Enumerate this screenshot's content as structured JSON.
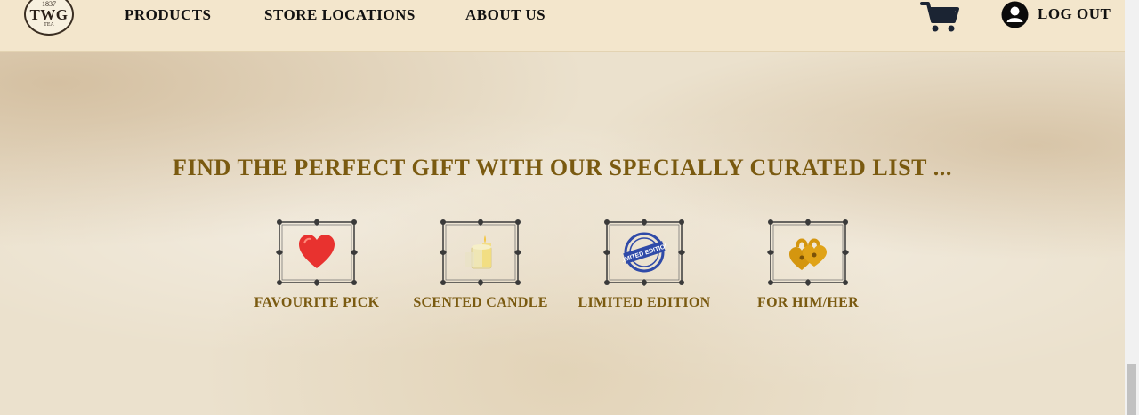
{
  "header": {
    "logo": {
      "year": "1837",
      "mark": "TWG",
      "sub": "TEA",
      "icon": "twg-tea-logo"
    },
    "nav": [
      {
        "id": "products",
        "label": "PRODUCTS"
      },
      {
        "id": "store-locations",
        "label": "STORE LOCATIONS"
      },
      {
        "id": "about-us",
        "label": "ABOUT US"
      }
    ],
    "cart_icon": "shopping-cart-icon",
    "account": {
      "icon": "user-circle-icon",
      "label": "LOG OUT"
    }
  },
  "main": {
    "heading": "FIND THE PERFECT GIFT WITH OUR SPECIALLY CURATED LIST ...",
    "gifts": [
      {
        "label": "FAVOURITE PICK",
        "icon": "heart-icon"
      },
      {
        "label": "SCENTED CANDLE",
        "icon": "candle-icon"
      },
      {
        "label": "LIMITED EDITION",
        "icon": "limited-edition-stamp-icon",
        "stamp_text": "LIMITED EDITION"
      },
      {
        "label": "FOR HIM/HER",
        "icon": "twin-hearts-lock-icon"
      }
    ]
  },
  "colors": {
    "header_bg": "#f3e6cc",
    "page_bg": "#ebe1cd",
    "accent_gold": "#7a5a10",
    "nav_text": "#111111",
    "heart_red": "#e8322f",
    "stamp_blue": "#2f4aa8",
    "lock_gold": "#d4960f"
  }
}
